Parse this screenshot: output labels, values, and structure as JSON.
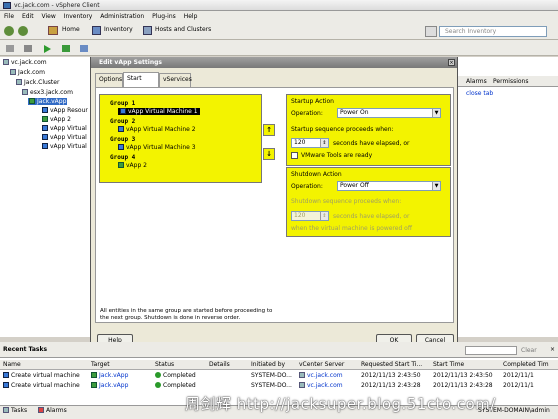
{
  "window": {
    "title": "vc.jack.com - vSphere Client"
  },
  "menu": [
    "File",
    "Edit",
    "View",
    "Inventory",
    "Administration",
    "Plug-ins",
    "Help"
  ],
  "nav": {
    "home": "Home",
    "inventory": "Inventory",
    "hosts_clusters": "Hosts and Clusters",
    "search_placeholder": "Search Inventory"
  },
  "tree": {
    "root": "vc.jack.com",
    "datacenter": "Jack.com",
    "cluster": "Jack.Cluster",
    "host": "esx3.jack.com",
    "vapp": "Jack.vApp",
    "children": [
      "vApp Resour",
      "vApp 2",
      "vApp Virtual",
      "vApp Virtual",
      "vApp Virtual"
    ]
  },
  "right_panel": {
    "tab_alarms": "Alarms",
    "tab_permissions": "Permissions",
    "close_tab": "close tab"
  },
  "dialog": {
    "title": "Edit vApp Settings",
    "tabs": [
      "Options",
      "Start Order",
      "vServices"
    ],
    "groups": [
      {
        "label": "Group 1",
        "items": [
          "vApp Virtual Machine 1"
        ]
      },
      {
        "label": "Group 2",
        "items": [
          "vApp Virtual Machine 2"
        ]
      },
      {
        "label": "Group 3",
        "items": [
          "vApp Virtual Machine 3"
        ]
      },
      {
        "label": "Group 4",
        "items": [
          "vApp 2"
        ]
      }
    ],
    "startup": {
      "header": "Startup Action",
      "operation_label": "Operation:",
      "operation_value": "Power On",
      "sequence_label": "Startup sequence proceeds when:",
      "seconds_value": "120",
      "seconds_label": "seconds have elapsed, or",
      "tools_label": "VMware Tools are ready"
    },
    "shutdown": {
      "header": "Shutdown Action",
      "operation_label": "Operation:",
      "operation_value": "Power Off",
      "sequence_label": "Shutdown sequence proceeds when:",
      "seconds_value": "120",
      "seconds_label": "seconds have elapsed, or",
      "powered_off_label": "when the virtual machine is powered off"
    },
    "notice": "All entities in the same group are started before proceeding to the next group. Shutdown is done in reverse order.",
    "buttons": {
      "help": "Help",
      "ok": "OK",
      "cancel": "Cancel"
    }
  },
  "recent_tasks": {
    "header": "Recent Tasks",
    "clear": "Clear",
    "columns": [
      "Name",
      "Target",
      "Status",
      "Details",
      "Initiated by",
      "vCenter Server",
      "Requested Start Ti...",
      "Start Time",
      "Completed Tim"
    ],
    "rows": [
      [
        "Create virtual machine",
        "Jack.vApp",
        "Completed",
        "",
        "SYSTEM-DO...",
        "vc.jack.com",
        "2012/11/13 2:43:50",
        "2012/11/13 2:43:50",
        "2012/11/1"
      ],
      [
        "Create virtual machine",
        "Jack.vApp",
        "Completed",
        "",
        "SYSTEM-DO...",
        "vc.jack.com",
        "2012/11/13 2:43:28",
        "2012/11/13 2:43:28",
        "2012/11/1"
      ]
    ]
  },
  "statusbar": {
    "tasks": "Tasks",
    "alarms": "Alarms",
    "user": "SYSTEM-DOMAIN\\admin"
  },
  "watermark": "周剑辉 http://jacksuper.blog.51cto.com/"
}
